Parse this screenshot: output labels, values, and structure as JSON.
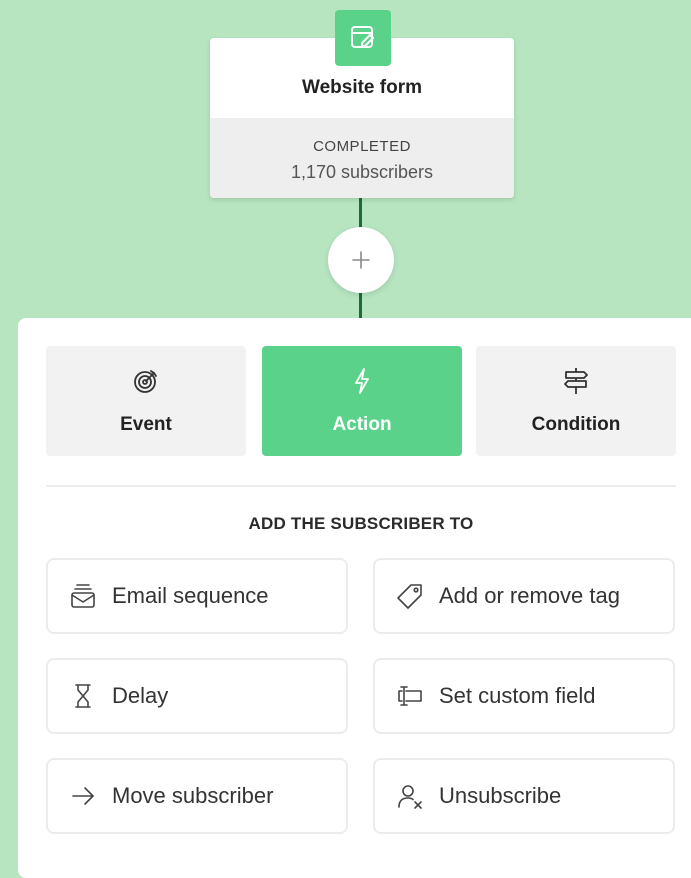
{
  "trigger": {
    "title": "Website form",
    "status": "COMPLETED",
    "subscribers": "1,170 subscribers",
    "icon": "form-edit-icon"
  },
  "add_step": {
    "icon": "plus-icon",
    "symbol": "+"
  },
  "tabs": [
    {
      "label": "Event",
      "icon": "target-icon",
      "active": false
    },
    {
      "label": "Action",
      "icon": "lightning-icon",
      "active": true
    },
    {
      "label": "Condition",
      "icon": "signpost-icon",
      "active": false
    }
  ],
  "section": {
    "title": "ADD THE SUBSCRIBER TO"
  },
  "options": [
    {
      "label": "Email sequence",
      "icon": "email-stack-icon"
    },
    {
      "label": "Add or remove tag",
      "icon": "tag-icon"
    },
    {
      "label": "Delay",
      "icon": "hourglass-icon"
    },
    {
      "label": "Set custom field",
      "icon": "text-cursor-field-icon"
    },
    {
      "label": "Move subscriber",
      "icon": "arrow-right-icon"
    },
    {
      "label": "Unsubscribe",
      "icon": "user-remove-icon"
    }
  ],
  "colors": {
    "background": "#b6e5c0",
    "accent": "#5ad28a",
    "connector": "#1d6b3a"
  }
}
